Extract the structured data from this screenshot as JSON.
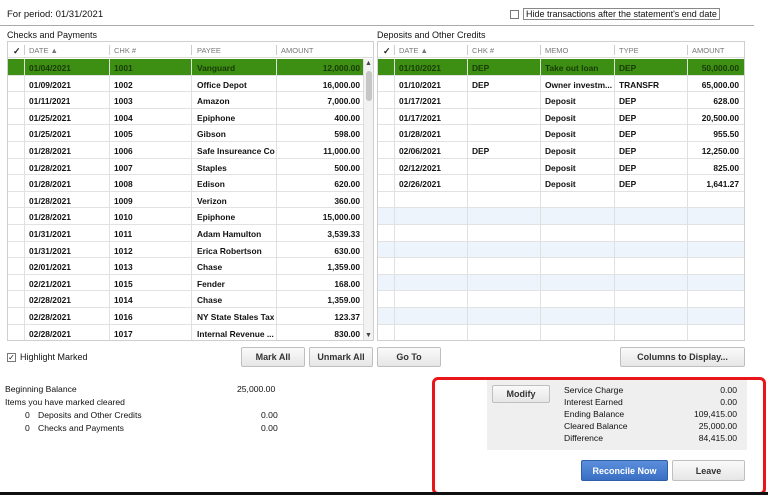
{
  "period": {
    "label": "For period: 01/31/2021"
  },
  "hide_option": {
    "label": "Hide transactions after the statement's end date",
    "checked": false
  },
  "checks": {
    "title": "Checks and Payments",
    "columns": [
      "✓",
      "DATE ▲",
      "CHK #",
      "PAYEE",
      "AMOUNT"
    ],
    "rows": [
      {
        "date": "01/04/2021",
        "chk": "1001",
        "payee": "Vanguard",
        "amount": "12,000.00",
        "selected": true
      },
      {
        "date": "01/09/2021",
        "chk": "1002",
        "payee": "Office Depot",
        "amount": "16,000.00"
      },
      {
        "date": "01/11/2021",
        "chk": "1003",
        "payee": "Amazon",
        "amount": "7,000.00"
      },
      {
        "date": "01/25/2021",
        "chk": "1004",
        "payee": "Epiphone",
        "amount": "400.00"
      },
      {
        "date": "01/25/2021",
        "chk": "1005",
        "payee": "Gibson",
        "amount": "598.00"
      },
      {
        "date": "01/28/2021",
        "chk": "1006",
        "payee": "Safe Insureance Co",
        "amount": "11,000.00"
      },
      {
        "date": "01/28/2021",
        "chk": "1007",
        "payee": "Staples",
        "amount": "500.00"
      },
      {
        "date": "01/28/2021",
        "chk": "1008",
        "payee": "Edison",
        "amount": "620.00"
      },
      {
        "date": "01/28/2021",
        "chk": "1009",
        "payee": "Verizon",
        "amount": "360.00"
      },
      {
        "date": "01/28/2021",
        "chk": "1010",
        "payee": "Epiphone",
        "amount": "15,000.00"
      },
      {
        "date": "01/31/2021",
        "chk": "1011",
        "payee": "Adam Hamulton",
        "amount": "3,539.33"
      },
      {
        "date": "01/31/2021",
        "chk": "1012",
        "payee": "Erica Robertson",
        "amount": "630.00"
      },
      {
        "date": "02/01/2021",
        "chk": "1013",
        "payee": "Chase",
        "amount": "1,359.00"
      },
      {
        "date": "02/21/2021",
        "chk": "1015",
        "payee": "Fender",
        "amount": "168.00"
      },
      {
        "date": "02/28/2021",
        "chk": "1014",
        "payee": "Chase",
        "amount": "1,359.00"
      },
      {
        "date": "02/28/2021",
        "chk": "1016",
        "payee": "NY State Stales Tax",
        "amount": "123.37"
      },
      {
        "date": "02/28/2021",
        "chk": "1017",
        "payee": "Internal Revenue ...",
        "amount": "830.00"
      }
    ]
  },
  "deposits": {
    "title": "Deposits and Other Credits",
    "columns": [
      "✓",
      "DATE ▲",
      "CHK #",
      "MEMO",
      "TYPE",
      "AMOUNT"
    ],
    "rows": [
      {
        "date": "01/10/2021",
        "chk": "DEP",
        "memo": "Take out loan",
        "type": "DEP",
        "amount": "50,000.00",
        "selected": true
      },
      {
        "date": "01/10/2021",
        "chk": "DEP",
        "memo": "Owner investm...",
        "type": "TRANSFR",
        "amount": "65,000.00"
      },
      {
        "date": "01/17/2021",
        "chk": "",
        "memo": "Deposit",
        "type": "DEP",
        "amount": "628.00"
      },
      {
        "date": "01/17/2021",
        "chk": "",
        "memo": "Deposit",
        "type": "DEP",
        "amount": "20,500.00"
      },
      {
        "date": "01/28/2021",
        "chk": "",
        "memo": "Deposit",
        "type": "DEP",
        "amount": "955.50"
      },
      {
        "date": "02/06/2021",
        "chk": "DEP",
        "memo": "Deposit",
        "type": "DEP",
        "amount": "12,250.00"
      },
      {
        "date": "02/12/2021",
        "chk": "",
        "memo": "Deposit",
        "type": "DEP",
        "amount": "825.00"
      },
      {
        "date": "02/26/2021",
        "chk": "",
        "memo": "Deposit",
        "type": "DEP",
        "amount": "1,641.27"
      }
    ],
    "empty_rows": 9
  },
  "buttons": {
    "mark_all": "Mark All",
    "unmark_all": "Unmark All",
    "go_to": "Go To",
    "columns": "Columns to Display...",
    "modify": "Modify",
    "reconcile": "Reconcile Now",
    "leave": "Leave"
  },
  "highlight": {
    "label": "Highlight Marked",
    "checked": true
  },
  "summary": {
    "beginning_label": "Beginning Balance",
    "beginning_value": "25,000.00",
    "marked_label": "Items you have marked cleared",
    "deposits_count": "0",
    "deposits_label": "Deposits and Other Credits",
    "deposits_value": "0.00",
    "checks_count": "0",
    "checks_label": "Checks and Payments",
    "checks_value": "0.00"
  },
  "totals": [
    {
      "label": "Service Charge",
      "value": "0.00"
    },
    {
      "label": "Interest Earned",
      "value": "0.00"
    },
    {
      "label": "Ending Balance",
      "value": "109,415.00"
    },
    {
      "label": "Cleared Balance",
      "value": "25,000.00"
    },
    {
      "label": "Difference",
      "value": "84,415.00"
    }
  ],
  "colors": {
    "selected_row": "#3c8f13",
    "highlight_box": "#e8151a",
    "primary_button": "#3a6fc4"
  }
}
